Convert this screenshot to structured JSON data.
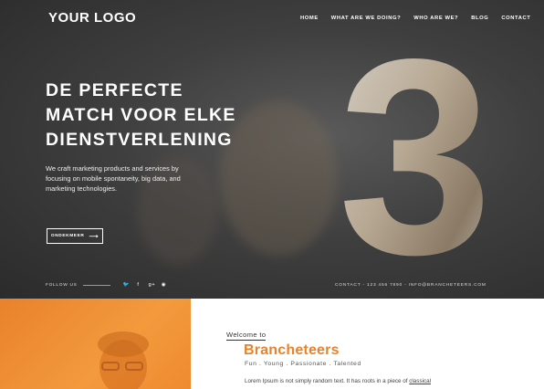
{
  "header": {
    "logo": "YOUR LOGO",
    "nav": [
      "HOME",
      "WHAT ARE WE DOING?",
      "WHO ARE WE?",
      "BLOG",
      "CONTACT"
    ]
  },
  "hero": {
    "headline_lines": [
      "DE PERFECTE",
      "MATCH VOOR ELKE",
      "DIENSTVERLENING"
    ],
    "subtext": "We craft marketing products and services by focusing on mobile spontaneity, big data, and marketing technologies.",
    "cta_label": "ONDEKMEER",
    "big_number": "3",
    "follow_label": "FOLLOW US",
    "social_icons": [
      "twitter-icon",
      "facebook-icon",
      "google-plus-icon",
      "rss-icon"
    ],
    "social_glyphs": [
      "🐦",
      "f",
      "g+",
      "◉"
    ],
    "contact_text": "CONTACT - 123 456 7890 - INFO@BRANCHETEERS.COM"
  },
  "intro": {
    "welcome": "Welcome to",
    "brand": "Brancheteers",
    "tagline": "Fun . Young . Passionate . Talented",
    "lorem_prefix": "Lorem Ipsum is not simply random text. It has roots in a piece of ",
    "lorem_link": "classical"
  },
  "colors": {
    "accent": "#e9822b",
    "hero_bg": "#3f3f3f"
  }
}
